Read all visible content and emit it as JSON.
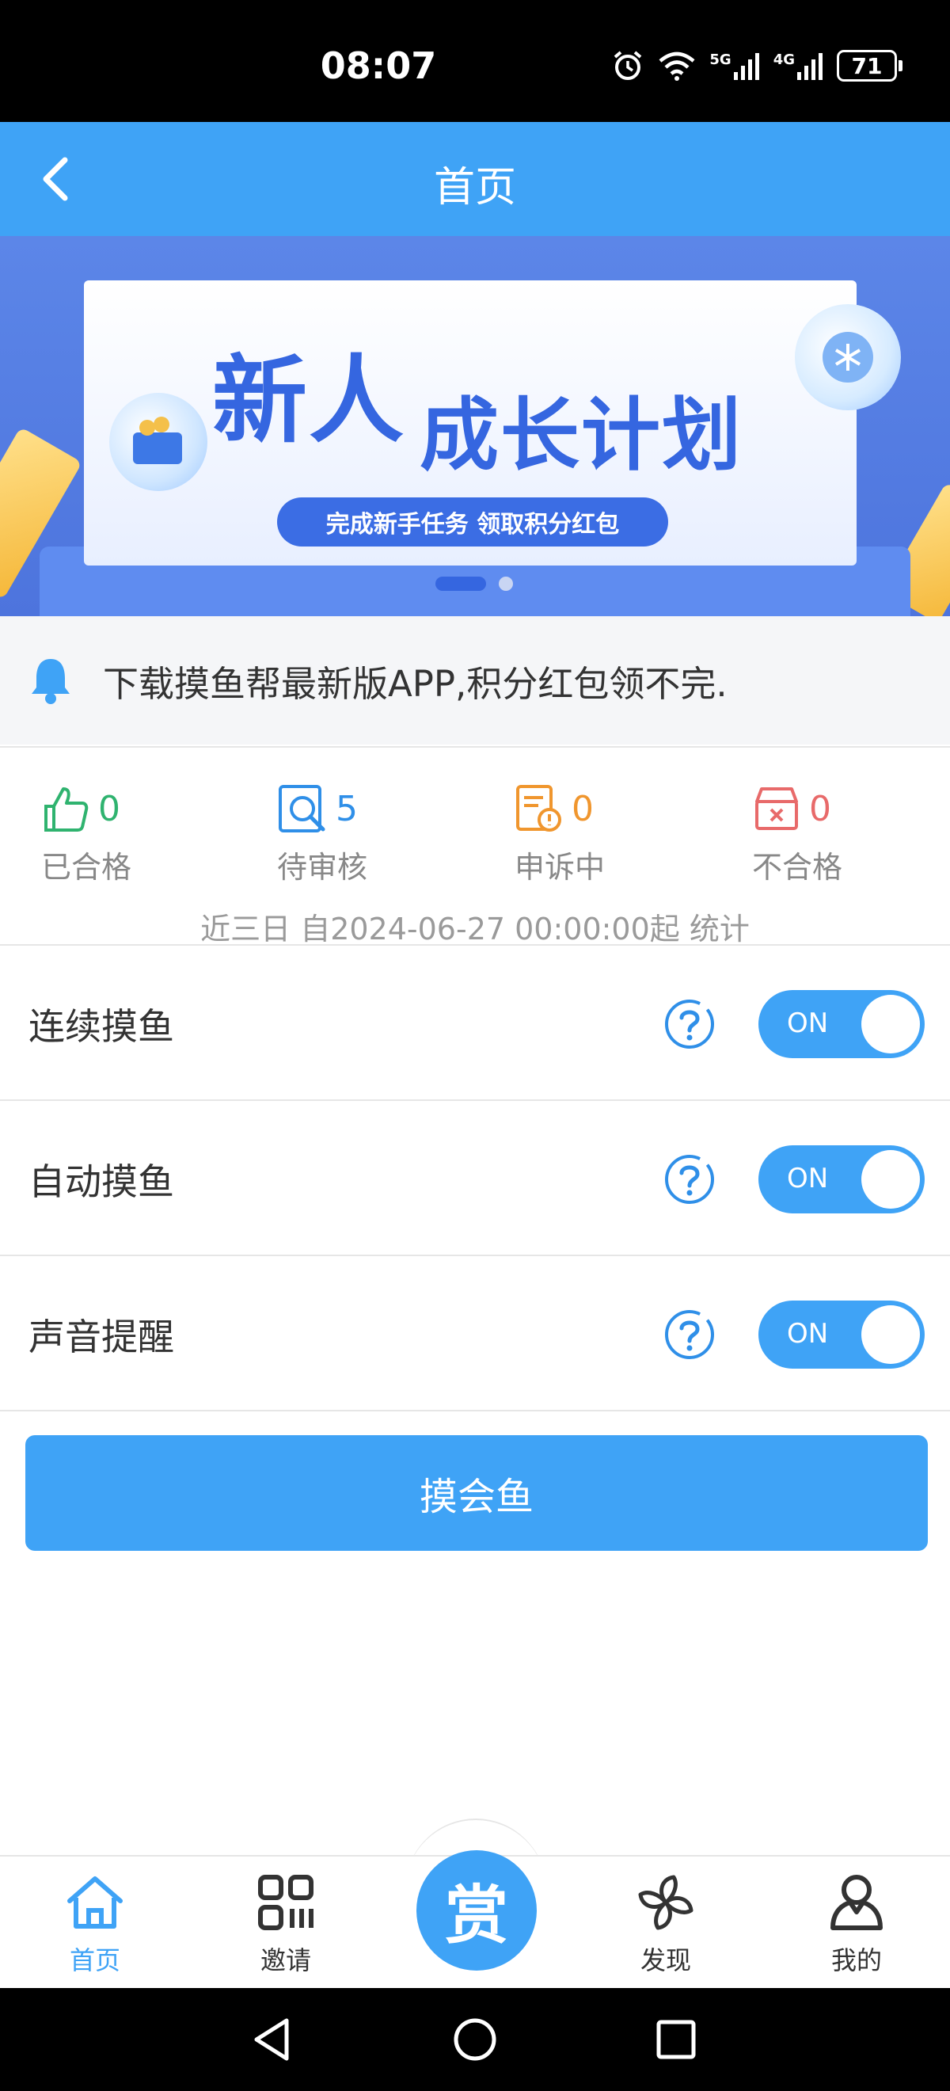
{
  "status_bar": {
    "time": "08:07",
    "network_1": "5G",
    "network_2": "4G",
    "battery": "71"
  },
  "header": {
    "title": "首页",
    "back_icon": "chevron-left-icon"
  },
  "banner": {
    "title_1": "新人",
    "title_2": "成长计划",
    "subtitle": "完成新手任务 领取积分红包"
  },
  "notice": {
    "icon": "bell-icon",
    "text": "下载摸鱼帮最新版APP,积分红包领不完."
  },
  "stats": {
    "items": [
      {
        "value": "0",
        "label": "已合格",
        "icon": "thumbs-up-icon",
        "color": "#2fb36f"
      },
      {
        "value": "5",
        "label": "待审核",
        "icon": "review-search-icon",
        "color": "#2f8fe8"
      },
      {
        "value": "0",
        "label": "申诉中",
        "icon": "appeal-document-icon",
        "color": "#f0962e"
      },
      {
        "value": "0",
        "label": "不合格",
        "icon": "rejected-box-icon",
        "color": "#e86a6a"
      }
    ],
    "note": "近三日 自2024-06-27 00:00:00起 统计"
  },
  "settings": [
    {
      "label": "连续摸鱼",
      "toggle": "ON"
    },
    {
      "label": "自动摸鱼",
      "toggle": "ON"
    },
    {
      "label": "声音提醒",
      "toggle": "ON"
    }
  ],
  "main_button": {
    "label": "摸会鱼"
  },
  "bottom_nav": {
    "home": "首页",
    "invite": "邀请",
    "reward": "赏",
    "discover": "发现",
    "mine": "我的"
  },
  "colors": {
    "primary": "#3fa3f6",
    "status_bar": "#000000"
  }
}
